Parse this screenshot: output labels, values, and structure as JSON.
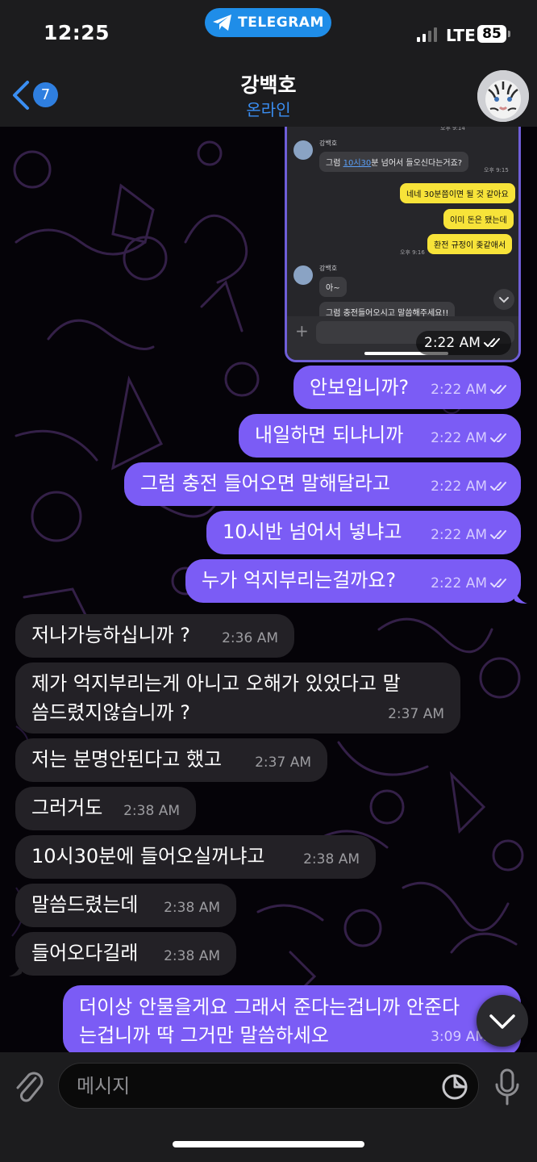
{
  "status_bar": {
    "time": "12:25",
    "app_pill": "TELEGRAM",
    "network": "LTE",
    "battery": "85"
  },
  "header": {
    "back_count": "7",
    "contact_name": "강백호",
    "contact_status": "온라인"
  },
  "screenshot": {
    "top_time": "오후 9:14",
    "sender1": "강백호",
    "g1_pre": "그럼 ",
    "g1_link": "10시30",
    "g1_post": "분 넘어서 들오신다는거죠?",
    "t1": "오후 9:15",
    "y1": "네네 30분쯤이면 될 것 같아요",
    "y2": "이미 돈은 됐는데",
    "y3": "환전 규정이 좆같애서",
    "t2": "오후 9:16",
    "sender2": "강백호",
    "g2": "아~",
    "g3": "그럼 충전들어오시고 말씀해주세요!!",
    "time": "2:22 AM"
  },
  "messages": [
    {
      "dir": "out",
      "text": "안보입니까?",
      "time": "2:22 AM"
    },
    {
      "dir": "out",
      "text": "내일하면 되냐니까",
      "time": "2:22 AM"
    },
    {
      "dir": "out",
      "text": "그럼 충전 들어오면 말해달라고",
      "time": "2:22 AM"
    },
    {
      "dir": "out",
      "text": "10시반 넘어서 넣냐고",
      "time": "2:22 AM"
    },
    {
      "dir": "out",
      "text": "누가 억지부리는걸까요?",
      "time": "2:22 AM"
    },
    {
      "dir": "in",
      "text": "저나가능하십니까 ?",
      "time": "2:36 AM"
    },
    {
      "dir": "in",
      "text": "제가 억지부리는게 아니고 오해가 있었다고 말",
      "text2": "씀드렸지않습니까 ?",
      "time": "2:37 AM"
    },
    {
      "dir": "in",
      "text": "저는 분명안된다고 했고",
      "time": "2:37 AM"
    },
    {
      "dir": "in",
      "text": "그러거도",
      "time": "2:38 AM"
    },
    {
      "dir": "in",
      "text": "10시30분에 들어오실꺼냐고",
      "time": "2:38 AM"
    },
    {
      "dir": "in",
      "text": "말씀드렸는데",
      "time": "2:38 AM"
    },
    {
      "dir": "in",
      "text": "들어오다길래",
      "time": "2:38 AM"
    },
    {
      "dir": "out",
      "text": "더이상 안물을게요 그래서 준다는겁니까 안준다",
      "text2": "는겁니까 딱 그거만 말씀하세오",
      "time": "3:09 AM"
    }
  ],
  "composer": {
    "placeholder": "메시지"
  },
  "icons": {
    "telegram": "telegram-plane-icon",
    "back": "chevron-left-icon",
    "checks": "double-check-icon",
    "scroll": "chevron-down-icon",
    "attach": "paperclip-icon",
    "sticker": "sticker-icon",
    "mic": "microphone-icon"
  },
  "colors": {
    "outgoing": "#7b5cf5",
    "incoming": "#232126",
    "accent": "#3a8ef2",
    "pill": "#1f8de8"
  }
}
